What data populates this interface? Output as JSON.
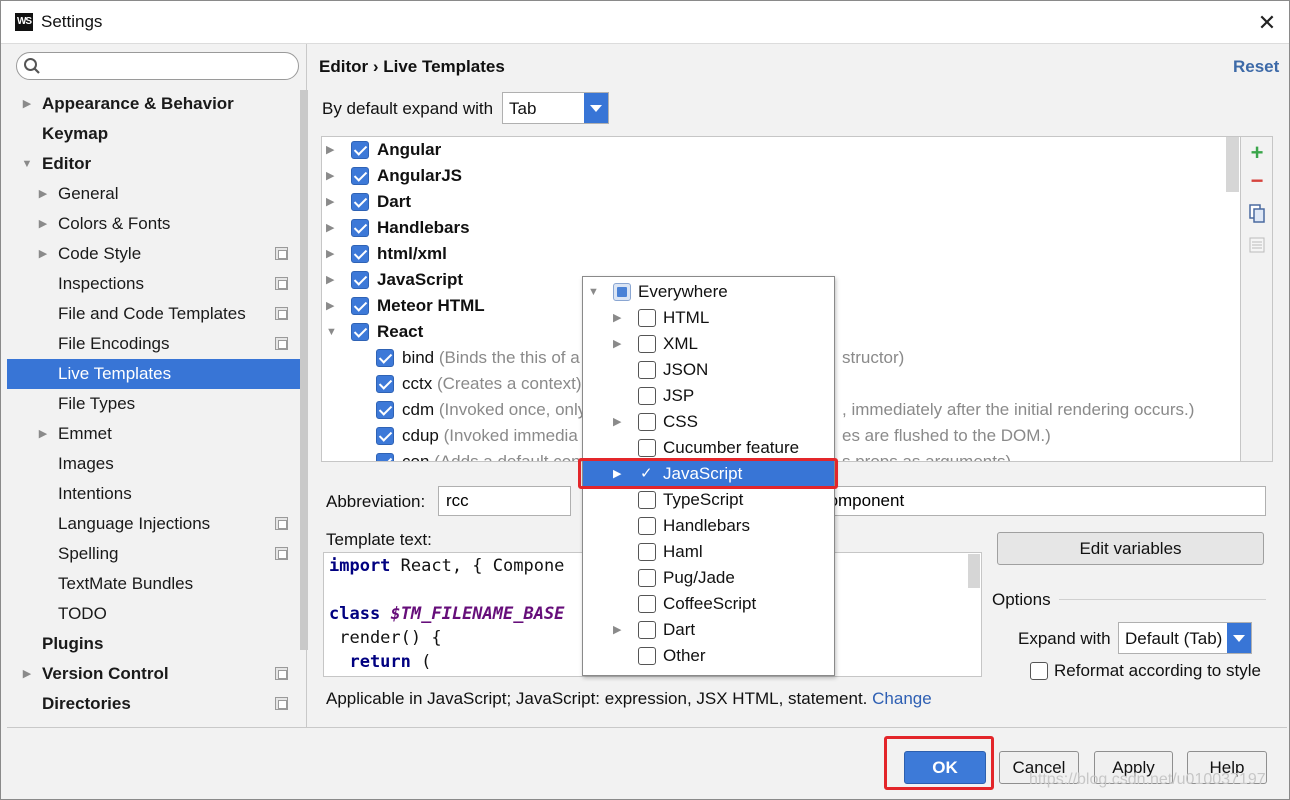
{
  "window": {
    "title": "Settings",
    "app_icon_text": "WS",
    "close_glyph": "✕"
  },
  "sidebar": {
    "search_placeholder": "",
    "items": [
      {
        "label": "Appearance & Behavior",
        "bold": true,
        "arrow": "right",
        "level": 0
      },
      {
        "label": "Keymap",
        "bold": true,
        "arrow": "none",
        "level": 0
      },
      {
        "label": "Editor",
        "bold": true,
        "arrow": "down",
        "level": 0
      },
      {
        "label": "General",
        "arrow": "right",
        "level": 1
      },
      {
        "label": "Colors & Fonts",
        "arrow": "right",
        "level": 1
      },
      {
        "label": "Code Style",
        "arrow": "right",
        "level": 1,
        "project_icon": true
      },
      {
        "label": "Inspections",
        "arrow": "none",
        "level": 1,
        "project_icon": true
      },
      {
        "label": "File and Code Templates",
        "arrow": "none",
        "level": 1,
        "project_icon": true
      },
      {
        "label": "File Encodings",
        "arrow": "none",
        "level": 1,
        "project_icon": true
      },
      {
        "label": "Live Templates",
        "arrow": "none",
        "level": 1,
        "selected": true
      },
      {
        "label": "File Types",
        "arrow": "none",
        "level": 1
      },
      {
        "label": "Emmet",
        "arrow": "right",
        "level": 1
      },
      {
        "label": "Images",
        "arrow": "none",
        "level": 1
      },
      {
        "label": "Intentions",
        "arrow": "none",
        "level": 1
      },
      {
        "label": "Language Injections",
        "arrow": "none",
        "level": 1,
        "project_icon": true
      },
      {
        "label": "Spelling",
        "arrow": "none",
        "level": 1,
        "project_icon": true
      },
      {
        "label": "TextMate Bundles",
        "arrow": "none",
        "level": 1
      },
      {
        "label": "TODO",
        "arrow": "none",
        "level": 1
      },
      {
        "label": "Plugins",
        "bold": true,
        "arrow": "none",
        "level": 0
      },
      {
        "label": "Version Control",
        "bold": true,
        "arrow": "right",
        "level": 0,
        "project_icon": true
      },
      {
        "label": "Directories",
        "bold": true,
        "arrow": "none",
        "level": 0,
        "project_icon": true
      }
    ]
  },
  "main": {
    "breadcrumb": "Editor › Live Templates",
    "reset": "Reset",
    "expand_label": "By default expand with",
    "expand_value": "Tab",
    "template_groups": [
      {
        "name": "Angular",
        "checked": true
      },
      {
        "name": "AngularJS",
        "checked": true
      },
      {
        "name": "Dart",
        "checked": true
      },
      {
        "name": "Handlebars",
        "checked": true
      },
      {
        "name": "html/xml",
        "checked": true
      },
      {
        "name": "JavaScript",
        "checked": true
      },
      {
        "name": "Meteor HTML",
        "checked": true
      },
      {
        "name": "React",
        "checked": true,
        "expanded": true
      }
    ],
    "react_items": [
      {
        "name": "bind",
        "desc_left": "(Binds the this of a",
        "desc_right": "structor)"
      },
      {
        "name": "cctx",
        "desc_left": "(Creates a context)",
        "desc_right": ""
      },
      {
        "name": "cdm",
        "desc_left": "(Invoked once, only",
        "desc_right": ", immediately after the initial rendering occurs.)"
      },
      {
        "name": "cdup",
        "desc_left": "(Invoked immedia",
        "desc_right": "es are flushed to the DOM.)"
      },
      {
        "name": "con",
        "desc_left": "(Adds a default con",
        "desc_right": "s props as arguments)"
      }
    ],
    "tools": {
      "add": "+",
      "remove": "−"
    },
    "abbreviation_label": "Abbreviation:",
    "abbreviation_value": "rcc",
    "description_value": "-order component",
    "template_text_label": "Template text:",
    "code_lines": [
      {
        "kw": "import",
        "rest": " React, { Compone"
      },
      {
        "kw": "",
        "rest": ""
      },
      {
        "kw": "class",
        "var": " $TM_FILENAME_BASE",
        "rest": ""
      },
      {
        "kw": "",
        "rest": " render() {"
      },
      {
        "kw": "  return",
        "rest": " ("
      }
    ],
    "edit_variables": "Edit variables",
    "options_label": "Options",
    "expand_with_label": "Expand with",
    "expand_with_value": "Default (Tab)",
    "reformat_label": "Reformat according to style",
    "applicable_text": "Applicable in JavaScript; JavaScript: expression, JSX HTML, statement.",
    "change_link": "Change"
  },
  "context_popup": {
    "items": [
      {
        "label": "Everywhere",
        "arrow": "down",
        "state": "partial",
        "level": 0
      },
      {
        "label": "HTML",
        "arrow": "right",
        "state": "empty",
        "level": 1
      },
      {
        "label": "XML",
        "arrow": "right",
        "state": "empty",
        "level": 1
      },
      {
        "label": "JSON",
        "arrow": "none",
        "state": "empty",
        "level": 1
      },
      {
        "label": "JSP",
        "arrow": "none",
        "state": "empty",
        "level": 1
      },
      {
        "label": "CSS",
        "arrow": "right",
        "state": "empty",
        "level": 1
      },
      {
        "label": "Cucumber feature",
        "arrow": "none",
        "state": "empty",
        "level": 1
      },
      {
        "label": "JavaScript",
        "arrow": "right",
        "state": "checked",
        "level": 1,
        "selected": true
      },
      {
        "label": "TypeScript",
        "arrow": "none",
        "state": "empty",
        "level": 1
      },
      {
        "label": "Handlebars",
        "arrow": "none",
        "state": "empty",
        "level": 1
      },
      {
        "label": "Haml",
        "arrow": "none",
        "state": "empty",
        "level": 1
      },
      {
        "label": "Pug/Jade",
        "arrow": "none",
        "state": "empty",
        "level": 1
      },
      {
        "label": "CoffeeScript",
        "arrow": "none",
        "state": "empty",
        "level": 1
      },
      {
        "label": "Dart",
        "arrow": "right",
        "state": "empty",
        "level": 1
      },
      {
        "label": "Other",
        "arrow": "none",
        "state": "empty",
        "level": 1
      }
    ]
  },
  "buttons": {
    "ok": "OK",
    "cancel": "Cancel",
    "apply": "Apply",
    "help": "Help"
  },
  "watermark": "https://blog.csdn.net/u010037197",
  "colors": {
    "accent": "#3875d6",
    "highlight_box": "#e3262a",
    "link": "#2e5fb3"
  }
}
